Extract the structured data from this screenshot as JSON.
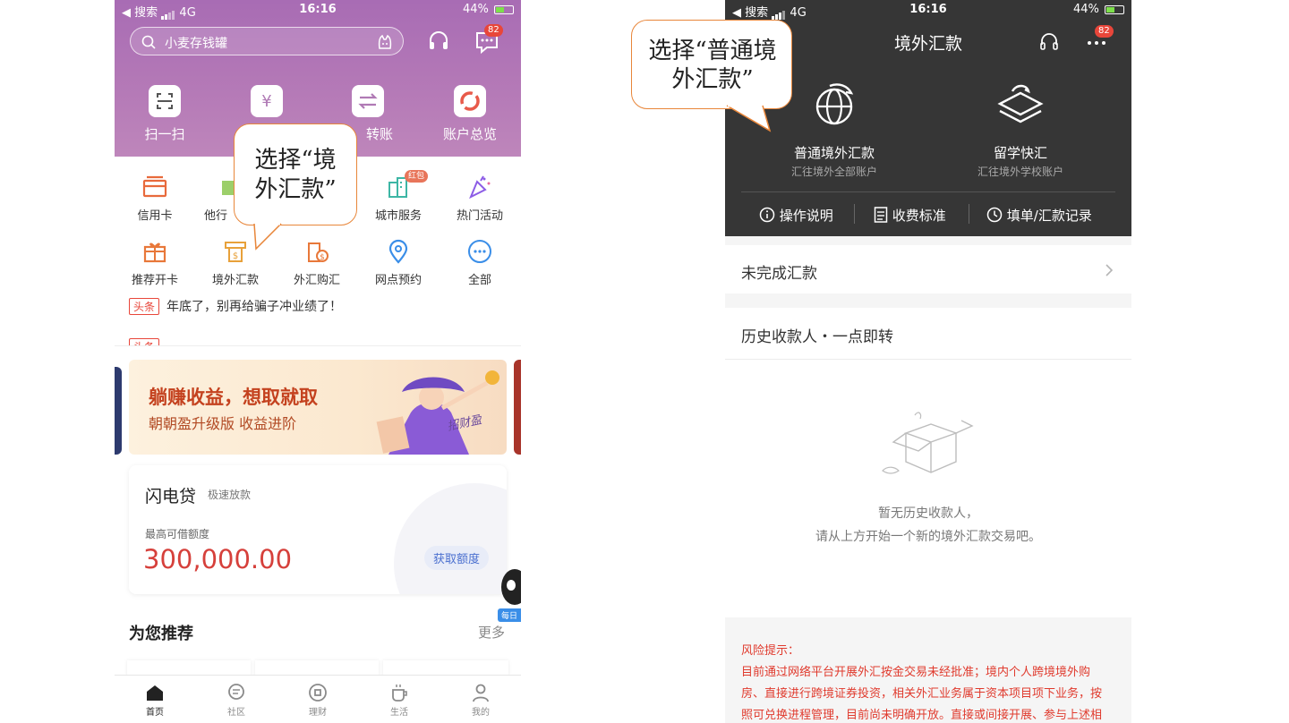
{
  "left": {
    "status": {
      "carrier": "◀ 搜索",
      "network": "4G",
      "time": "16:16",
      "battery": "44%"
    },
    "search": {
      "placeholder": "小麦存钱罐",
      "messages_badge": "82"
    },
    "quick_actions": [
      {
        "label": "扫一扫",
        "icon": "scan-icon"
      },
      {
        "label": "收支",
        "icon": "yuan-icon"
      },
      {
        "label": "转账",
        "icon": "transfer-icon"
      },
      {
        "label": "账户总览",
        "icon": "overview-icon"
      }
    ],
    "services_row1": [
      {
        "label": "信用卡",
        "icon": "credit-card-icon"
      },
      {
        "label": "他行",
        "icon": "other-bank-icon"
      },
      {
        "label": "",
        "icon": ""
      },
      {
        "label": "城市服务",
        "icon": "city-service-icon",
        "badge": "红包"
      },
      {
        "label": "热门活动",
        "icon": "party-popper-icon"
      }
    ],
    "services_row2": [
      {
        "label": "推荐开卡",
        "icon": "gift-card-icon"
      },
      {
        "label": "境外汇款",
        "icon": "overseas-remittance-icon"
      },
      {
        "label": "外汇购汇",
        "icon": "forex-purchase-icon"
      },
      {
        "label": "网点预约",
        "icon": "location-pin-icon"
      },
      {
        "label": "全部",
        "icon": "more-icon"
      }
    ],
    "news": {
      "tag": "头条",
      "line1": "年底了，别再给骗子冲业绩了！"
    },
    "banner": {
      "title": "躺赚收益，想取就取",
      "subtitle": "朝朝盈升级版 收益进阶",
      "logo_text": "招财盈"
    },
    "loan_card": {
      "title": "闪电贷",
      "tag": "极速放款",
      "limit_label": "最高可借额度",
      "amount": "300,000.00",
      "button": "获取额度"
    },
    "recommend": {
      "title": "为您推荐",
      "more": "更多"
    },
    "float_badge": "每日",
    "tabs": [
      {
        "label": "首页",
        "icon": "home-icon"
      },
      {
        "label": "社区",
        "icon": "community-icon"
      },
      {
        "label": "理财",
        "icon": "wealth-icon"
      },
      {
        "label": "生活",
        "icon": "coffee-icon"
      },
      {
        "label": "我的",
        "icon": "profile-icon"
      }
    ],
    "callout": "选择“境外汇款”"
  },
  "right": {
    "status": {
      "carrier": "◀ 搜索",
      "network": "4G",
      "time": "16:16",
      "battery": "44%"
    },
    "title": "境外汇款",
    "menu_badge": "82",
    "options": [
      {
        "title": "普通境外汇款",
        "subtitle": "汇往境外全部账户",
        "icon": "globe-icon"
      },
      {
        "title": "留学快汇",
        "subtitle": "汇往境外学校账户",
        "icon": "graduation-cap-icon"
      }
    ],
    "actions": [
      {
        "label": "操作说明",
        "icon": "info-icon"
      },
      {
        "label": "收费标准",
        "icon": "document-icon"
      },
      {
        "label": "填单/汇款记录",
        "icon": "clock-icon"
      }
    ],
    "incomplete": "未完成汇款",
    "history_title": "历史收款人・一点即转",
    "empty_line1": "暂无历史收款人，",
    "empty_line2": "请从上方开始一个新的境外汇款交易吧。",
    "risk_title": "风险提示：",
    "risk_lines": [
      "目前通过网络平台开展外汇按金交易未经批准；境内个人跨境境外购",
      "房、直接进行跨境证券投资，相关外汇业务属于资本项目项下业务，按",
      "照可兑换进程管理，目前尚未明确开放。直接或间接开展、参与上述相"
    ],
    "callout": "选择“普通境外汇款”"
  },
  "colors": {
    "accent_purple": "#b57ab7",
    "dark_header": "#363636",
    "callout_border": "#e8863a",
    "risk_red": "#e03a2d",
    "amount_red": "#d6403b"
  }
}
